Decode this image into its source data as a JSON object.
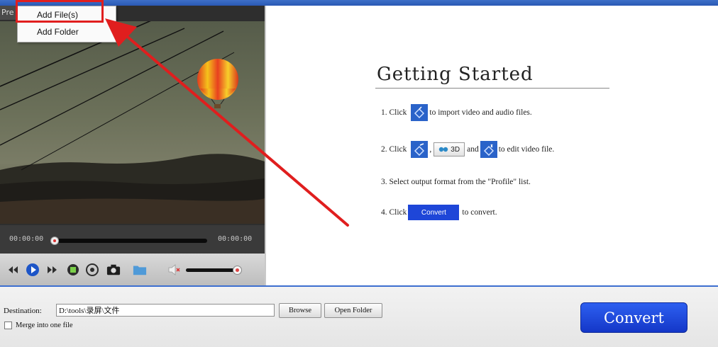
{
  "preview": {
    "tab_label": "Pre",
    "time_start": "00:00:00",
    "time_end": "00:00:00"
  },
  "menu": {
    "items": [
      {
        "label": "Add File(s)"
      },
      {
        "label": "Add Folder"
      }
    ]
  },
  "getting_started": {
    "title": "Getting Started",
    "step1": {
      "prefix": "1. Click",
      "suffix": "to import video and audio files."
    },
    "step2": {
      "prefix": "2. Click",
      "sep": ",",
      "btn3d": "3D",
      "and": "and",
      "suffix": "to edit video file."
    },
    "step3": {
      "text": "3. Select output format from the \"Profile\" list."
    },
    "step4": {
      "prefix": "4. Click",
      "button": "Convert",
      "suffix": "to convert."
    }
  },
  "bottom": {
    "destination_label": "Destination:",
    "destination_value": "D:\\tools\\录屏\\文件",
    "browse_label": "Browse",
    "open_folder_label": "Open Folder",
    "merge_label": "Merge into one file",
    "merge_checked": false,
    "convert_label": "Convert"
  },
  "colors": {
    "accent_blue": "#2a63c9",
    "convert_blue": "#1e46d8",
    "highlight_red": "#e01e1e"
  },
  "icons": [
    "import-icon",
    "edit-icon",
    "effect-icon",
    "3d-glasses-icon",
    "prev-icon",
    "play-icon",
    "next-icon",
    "stop-icon",
    "frame-icon",
    "snapshot-icon",
    "folder-icon",
    "volume-icon"
  ]
}
